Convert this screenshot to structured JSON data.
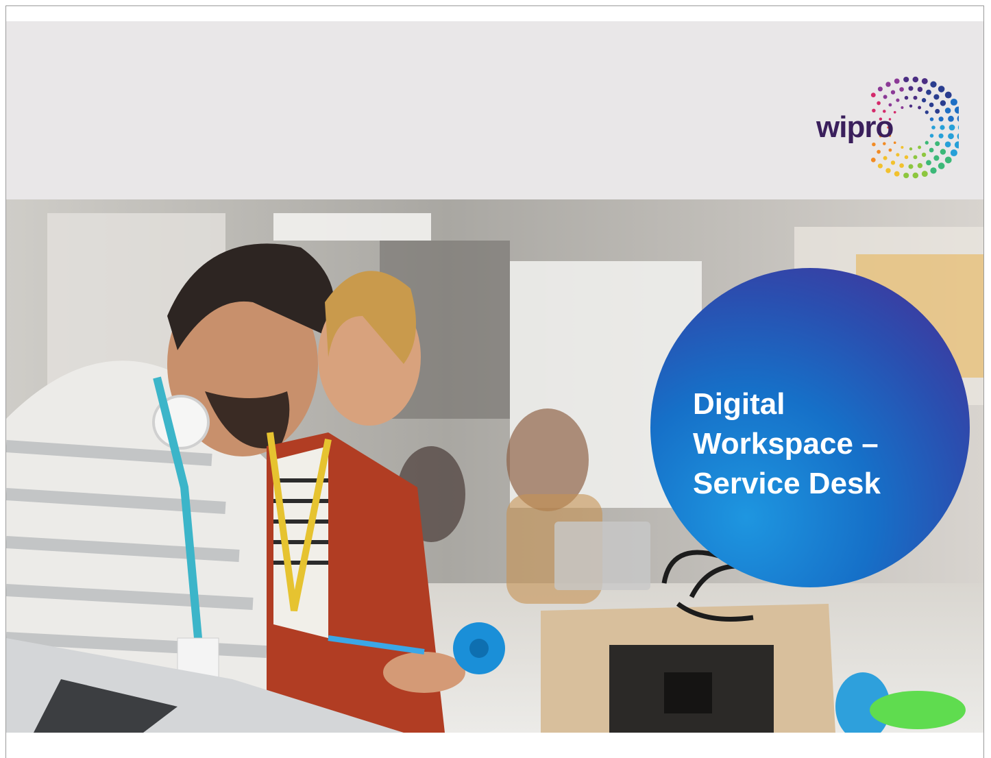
{
  "brand": {
    "logo_text": "wipro"
  },
  "cover": {
    "title_lines": [
      "Digital",
      "Workspace –",
      "Service Desk"
    ]
  },
  "photo": {
    "description_icon": "office-team-3d-printer-photo"
  },
  "colors": {
    "header_band": "#e9e7e8",
    "circle_gradient": [
      "#1e96e0",
      "#1670c8",
      "#2a4fb0",
      "#4a2c94"
    ],
    "logo_text": "#3a1f5c"
  }
}
